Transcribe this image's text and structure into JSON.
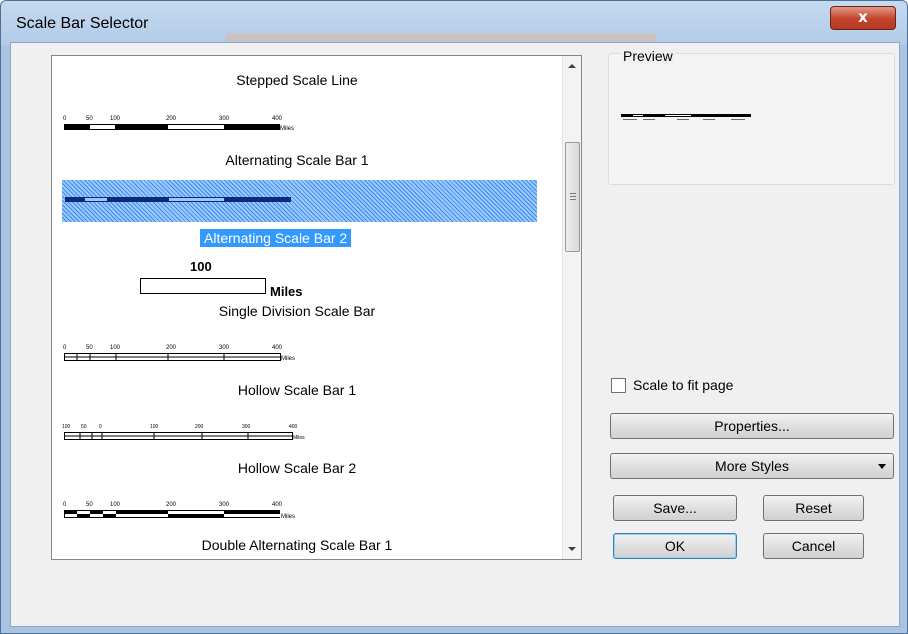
{
  "window": {
    "title": "Scale Bar Selector",
    "close_glyph": "x"
  },
  "list": {
    "items": [
      {
        "label": "Stepped Scale Line",
        "ticks": []
      },
      {
        "label": "Alternating Scale Bar 1",
        "ticks": [
          "0",
          "50",
          "100",
          "200",
          "300",
          "400"
        ],
        "units": "Miles"
      },
      {
        "label": "Alternating Scale Bar 2",
        "selected": true
      },
      {
        "label": "Single Division Scale Bar",
        "value": "100",
        "units": "Miles"
      },
      {
        "label": "Hollow Scale Bar 1",
        "ticks": [
          "0",
          "50",
          "100",
          "200",
          "300",
          "400"
        ],
        "units": "Miles"
      },
      {
        "label": "Hollow Scale Bar 2",
        "ticks": [
          "100",
          "50",
          "0",
          "100",
          "200",
          "300",
          "400"
        ],
        "units": "Miles"
      },
      {
        "label": "Double Alternating Scale Bar 1",
        "ticks": [
          "0",
          "50",
          "100",
          "200",
          "300",
          "400"
        ],
        "units": "Miles"
      }
    ]
  },
  "preview": {
    "label": "Preview"
  },
  "options": {
    "scale_to_fit": "Scale to fit page",
    "scale_to_fit_checked": false
  },
  "buttons": {
    "properties": "Properties...",
    "more_styles": "More Styles",
    "save": "Save...",
    "reset": "Reset",
    "ok": "OK",
    "cancel": "Cancel"
  },
  "colors": {
    "selection": "#3399ff",
    "titlebar": "#b9d1ea",
    "close": "#c7432b"
  }
}
